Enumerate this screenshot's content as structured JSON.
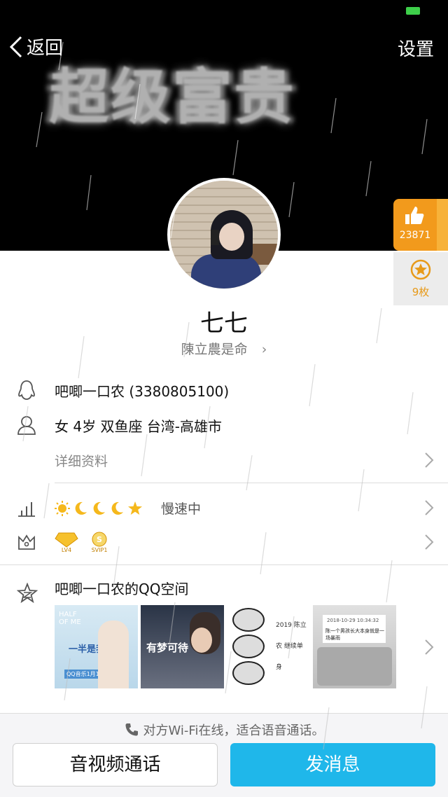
{
  "status_bar": {
    "battery_color": "#3ecf4a"
  },
  "nav": {
    "back_label": "返回",
    "settings_label": "设置"
  },
  "banner": {
    "title": "超级富贵"
  },
  "badges": {
    "likes": "23871",
    "medals": "9枚"
  },
  "profile": {
    "nickname": "七七",
    "signature": "陳立農是命",
    "qq": "吧唧一口农 (3380805100)",
    "info": "女 4岁 双鱼座 台湾-高雄市",
    "details_label": "详细资料",
    "speed_text": "慢速中",
    "vip_badges": [
      "LV4",
      "SVIP1"
    ]
  },
  "space": {
    "title": "吧唧一口农的QQ空间",
    "thumbnails": [
      {
        "label": "HALF OF ME",
        "text": "一半是我",
        "caption": "QQ音乐1月1日首发"
      },
      {
        "label": "",
        "text": "有梦可待",
        "caption": ""
      },
      {
        "label": "",
        "text": "",
        "caption": ""
      },
      {
        "label": "2019 陈立农 继续单身",
        "text": "",
        "caption": ""
      },
      {
        "label": "2018-10-29 10:34:32",
        "text": "陈一个男孩长大本身就是一场暴雨",
        "caption": ""
      }
    ]
  },
  "footer": {
    "wifi_tip": "对方Wi-Fi在线，适合语音通话。",
    "call_label": "音视频通话",
    "message_label": "发消息"
  },
  "colors": {
    "accent_blue": "#1fb7ea",
    "like_orange": "#f29a1c",
    "medal_gold": "#e79a1a"
  }
}
